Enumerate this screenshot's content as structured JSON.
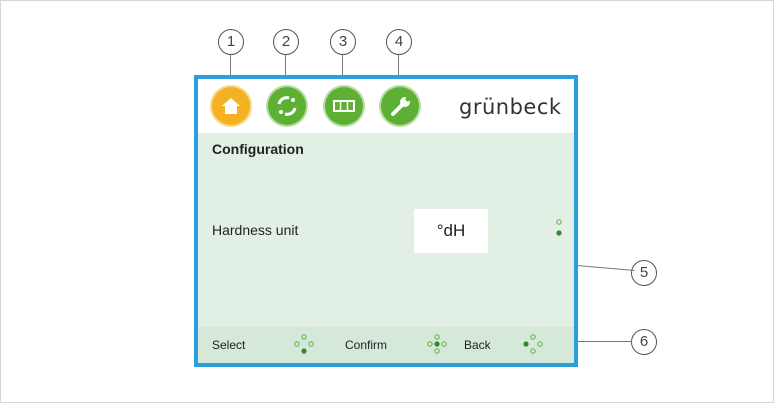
{
  "callouts": [
    "1",
    "2",
    "3",
    "4",
    "5",
    "6"
  ],
  "header": {
    "brand": "grünbeck",
    "icons": [
      "home-icon",
      "regeneration-icon",
      "counter-icon",
      "wrench-icon"
    ],
    "colors": {
      "home": "#f4b223",
      "nav": "#5db034",
      "border": "#2a9fdc"
    }
  },
  "main": {
    "title": "Configuration",
    "parameter": {
      "label": "Hardness unit",
      "value": "°dH"
    }
  },
  "footer": {
    "select_label": "Select",
    "confirm_label": "Confirm",
    "back_label": "Back"
  }
}
